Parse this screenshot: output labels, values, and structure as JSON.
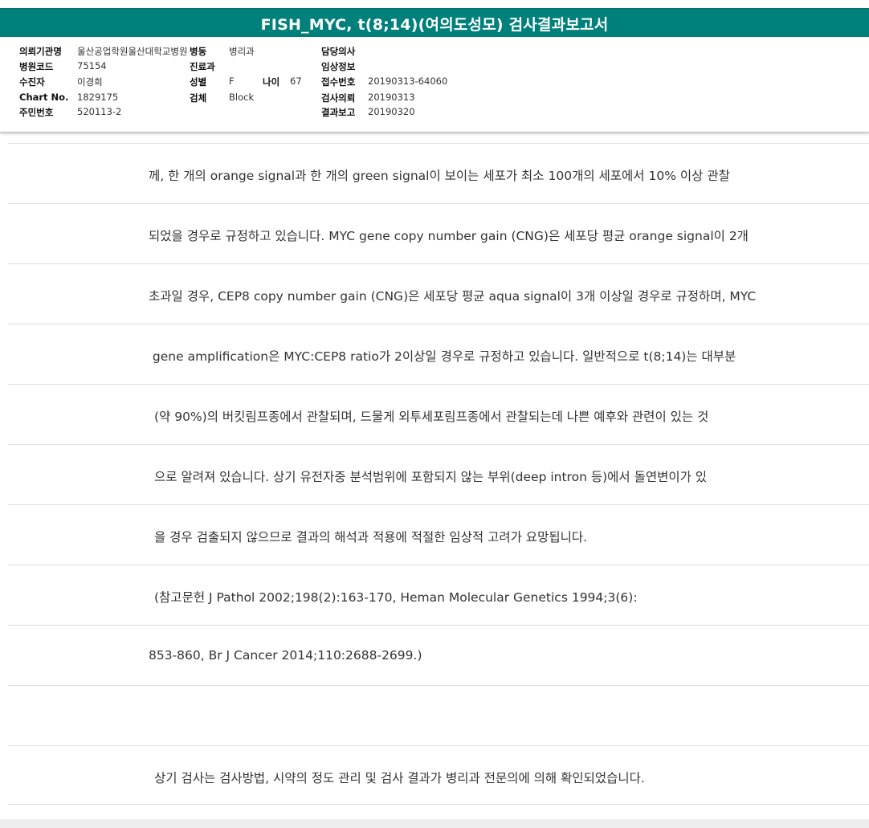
{
  "report_title": "FISH_MYC, t(8;14)(여의도성모) 검사결과보고서",
  "header": {
    "institution_label": "의뢰기관명",
    "institution_value": "울산공업학원울산대학교병원",
    "ward_label": "병동",
    "ward_value": "병리과",
    "doctor_label": "담당의사",
    "doctor_value": "",
    "hospital_code_label": "병원코드",
    "hospital_code_value": "75154",
    "dept_label": "진료과",
    "dept_value": "",
    "clinical_info_label": "임상정보",
    "clinical_info_value": "",
    "patient_label": "수진자",
    "patient_value": "이경희",
    "sex_label": "성별",
    "sex_value": "F",
    "age_label": "나이",
    "age_value": "67",
    "receipt_label": "접수번호",
    "receipt_value": "20190313-64060",
    "chart_label": "Chart No.",
    "chart_value": "1829175",
    "specimen_label": "검체",
    "specimen_value": "Block",
    "request_label": "검사의뢰",
    "request_value": "20190313",
    "id_label": "주민번호",
    "id_value": "520113-2",
    "result_label": "결과보고",
    "result_value": "20190320"
  },
  "body_lines": [
    "께, 한 개의 orange signal과 한 개의 green signal이 보이는 세포가 최소 100개의 세포에서 10% 이상 관찰",
    "되었을 경우로 규정하고 있습니다. MYC gene copy number gain (CNG)은 세포당 평균 orange signal이 2개",
    "초과일 경우, CEP8 copy number gain (CNG)은 세포당 평균 aqua signal이 3개 이상일 경우로 규정하며, MYC",
    " gene amplification은 MYC:CEP8 ratio가 2이상일 경우로 규정하고 있습니다. 일반적으로 t(8;14)는 대부분",
    "(약 90%)의 버킷림프종에서 관찰되며, 드물게 외투세포림프종에서 관찰되는데 나쁜 예후와 관련이 있는 것",
    "으로 알려져 있습니다. 상기 유전자중 분석범위에 포함되지 않는 부위(deep intron 등)에서 돌연변이가 있",
    "을 경우 검출되지 않으므로 결과의 해석과 적용에 적절한 임상적 고려가 요망됩니다.",
    "(참고문헌 J Pathol 2002;198(2):163-170, Heman Molecular Genetics 1994;3(6):",
    "853-860, Br J Cancer 2014;110:2688-2699.)",
    "",
    "상기 검사는 검사방법, 시약의 정도 관리 및 검사 결과가 병리과 전문의에 의해 확인되었습니다."
  ],
  "colors": {
    "title_bar": "#00807a",
    "rule": "#dedede"
  }
}
